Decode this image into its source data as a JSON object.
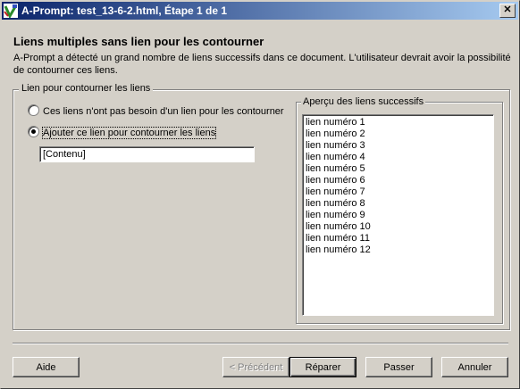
{
  "window": {
    "title": "A-Prompt: test_13-6-2.html, Étape 1 de 1",
    "close_label": "✕"
  },
  "heading": "Liens multiples sans lien pour les contourner",
  "description": "A-Prompt a détecté un grand nombre de liens successifs dans ce document. L'utilisateur devrait avoir la possibilité de contourner ces liens.",
  "group": {
    "title": "Lien pour contourner les liens",
    "option1_label": "Ces liens n'ont pas besoin d'un lien pour les contourner",
    "option2_label": "Ajouter ce lien pour contourner les liens",
    "selected_option": 2,
    "link_text_value": "[Contenu]"
  },
  "preview": {
    "title": "Aperçu des liens successifs",
    "items": [
      "lien numéro 1",
      "lien numéro 2",
      "lien numéro 3",
      "lien numéro 4",
      "lien numéro 5",
      "lien numéro 6",
      "lien numéro 7",
      "lien numéro 8",
      "lien numéro 9",
      "lien numéro 10",
      "lien numéro 11",
      "lien numéro 12"
    ]
  },
  "buttons": {
    "help": "Aide",
    "previous": "< Précédent",
    "repair": "Réparer",
    "skip": "Passer",
    "cancel": "Annuler"
  },
  "colors": {
    "titlebar_start": "#0a246a",
    "titlebar_end": "#a6caf0",
    "face": "#d4d0c8"
  }
}
